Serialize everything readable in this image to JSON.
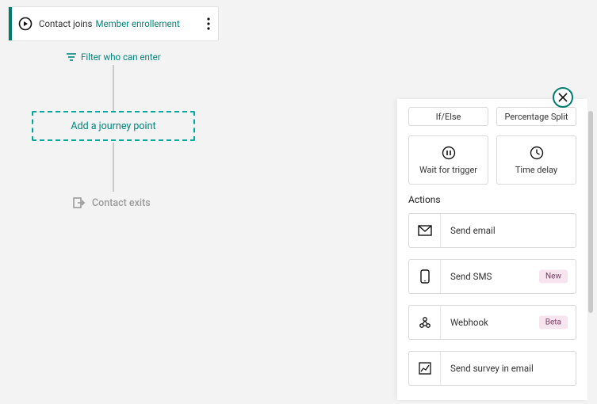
{
  "start": {
    "joins_label": "Contact joins",
    "segment_link": "Member enrollement"
  },
  "filter_label": "Filter who can enter",
  "add_point_label": "Add a journey point",
  "exit_label": "Contact exits",
  "panel": {
    "rules": {
      "if_else": "If/Else",
      "percentage_split": "Percentage Split",
      "wait_trigger": "Wait for trigger",
      "time_delay": "Time delay"
    },
    "actions_title": "Actions",
    "actions": {
      "send_email": "Send email",
      "send_sms": "Send SMS",
      "webhook": "Webhook",
      "send_survey": "Send survey in email"
    },
    "badges": {
      "new": "New",
      "beta": "Beta"
    }
  }
}
